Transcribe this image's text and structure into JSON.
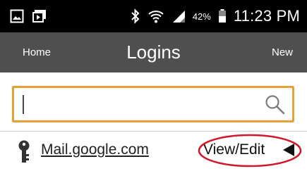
{
  "status_bar": {
    "icons": [
      "gallery-icon",
      "camera-icon",
      "bluetooth-icon",
      "wifi-icon",
      "signal-icon"
    ],
    "battery_percent": "42%",
    "time": "11:23 PM"
  },
  "header": {
    "home_label": "Home",
    "title": "Logins",
    "new_label": "New",
    "background": "#4f4f4f"
  },
  "search": {
    "value": "",
    "placeholder": "",
    "border_color": "#e8a234",
    "icon": "search-icon"
  },
  "logins": [
    {
      "icon": "key-icon",
      "site": "Mail.google.com",
      "action_label": "View/Edit",
      "action_icon": "arrow-left-icon",
      "highlight_color": "#d0172b"
    }
  ]
}
